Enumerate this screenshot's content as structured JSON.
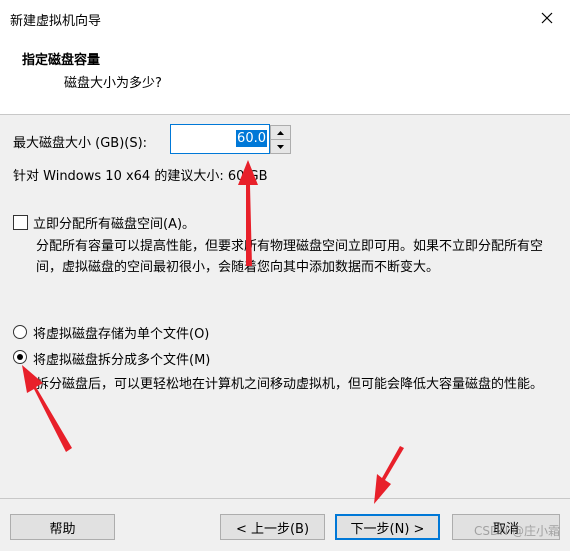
{
  "window": {
    "title": "新建虚拟机向导"
  },
  "header": {
    "title": "指定磁盘容量",
    "subtitle": "磁盘大小为多少?"
  },
  "disk_size": {
    "label": "最大磁盘大小 (GB)(S):",
    "value": "60.0",
    "recommend": "针对 Windows 10 x64 的建议大小: 60 GB"
  },
  "allocate": {
    "label": "立即分配所有磁盘空间(A)。",
    "checked": false,
    "desc": "分配所有容量可以提高性能，但要求所有物理磁盘空间立即可用。如果不立即分配所有空间，虚拟磁盘的空间最初很小，会随着您向其中添加数据而不断变大。"
  },
  "storage_options": [
    {
      "label": "将虚拟磁盘存储为单个文件(O)",
      "selected": false
    },
    {
      "label": "将虚拟磁盘拆分成多个文件(M)",
      "selected": true
    }
  ],
  "split_desc": "拆分磁盘后，可以更轻松地在计算机之间移动虚拟机，但可能会降低大容量磁盘的性能。",
  "buttons": {
    "help": "帮助",
    "back": "< 上一步(B)",
    "next": "下一步(N) >",
    "cancel": "取消"
  },
  "watermark": "CSDN @庄小霜",
  "colors": {
    "accent": "#0078d7",
    "annotation_arrow": "#e8202a"
  }
}
